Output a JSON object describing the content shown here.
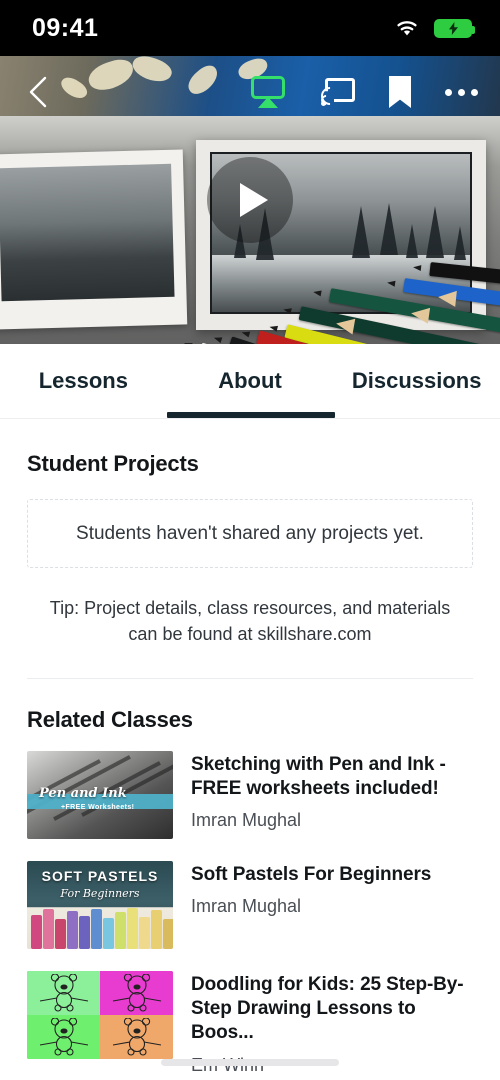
{
  "status_bar": {
    "time": "09:41",
    "wifi_icon": "wifi-icon",
    "battery_icon": "battery-charging-icon"
  },
  "hero": {
    "back_icon": "back-chevron-icon",
    "airplay_icon": "airplay-icon",
    "cast_icon": "chromecast-icon",
    "bookmark_icon": "bookmark-icon",
    "more_icon": "more-options-icon",
    "play_icon": "play-icon",
    "airplay_color": "#35e06a"
  },
  "tabs": [
    {
      "label": "Lessons",
      "active": false
    },
    {
      "label": "About",
      "active": true
    },
    {
      "label": "Discussions",
      "active": false
    }
  ],
  "student_projects": {
    "heading": "Student Projects",
    "empty_message": "Students haven't shared any projects yet.",
    "tip": "Tip: Project details, class resources, and materials can be found at skillshare.com"
  },
  "related_classes": {
    "heading": "Related Classes",
    "items": [
      {
        "title": "Sketching with Pen and Ink - FREE worksheets included!",
        "author": "Imran Mughal",
        "thumb_text": "Pen and Ink",
        "thumb_subtext": "+FREE Worksheets!"
      },
      {
        "title": "Soft Pastels For Beginners",
        "author": "Imran Mughal",
        "thumb_text": "SOFT PASTELS",
        "thumb_subtext": "For Beginners"
      },
      {
        "title": "Doodling for Kids: 25 Step-By-Step Drawing Lessons to Boos...",
        "author": "Em Winn",
        "thumb_text": "",
        "thumb_subtext": ""
      }
    ]
  },
  "colors": {
    "accent_underline": "#16262e",
    "text_primary": "#13171a",
    "text_secondary": "#4a4f55"
  }
}
